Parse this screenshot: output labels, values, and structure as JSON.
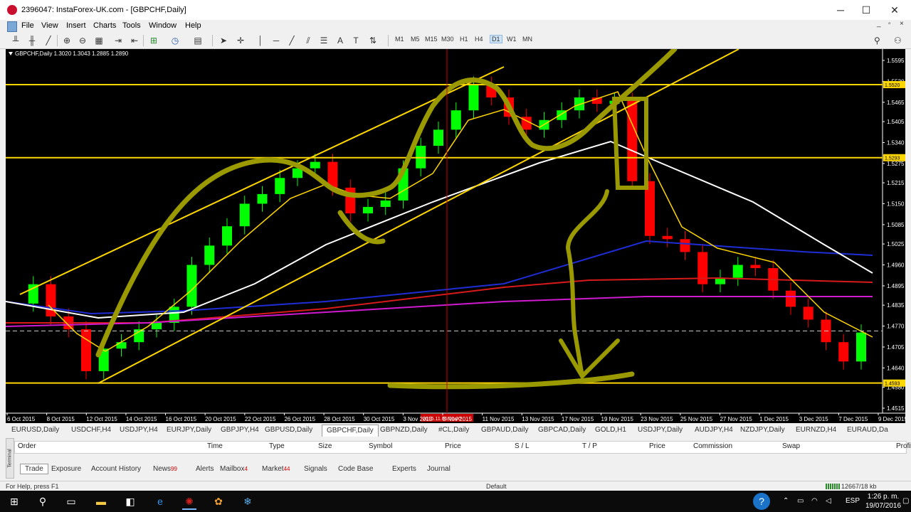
{
  "window": {
    "title": "2396047: InstaForex-UK.com - [GBPCHF,Daily]",
    "min": "─",
    "max": "☐",
    "close": "✕"
  },
  "menu": {
    "items": [
      "File",
      "View",
      "Insert",
      "Charts",
      "Tools",
      "Window",
      "Help"
    ],
    "mdi": [
      "_",
      "▫",
      "×"
    ]
  },
  "timeframes": [
    "M1",
    "M5",
    "M15",
    "M30",
    "H1",
    "H4",
    "D1",
    "W1",
    "MN"
  ],
  "active_timeframe": "D1",
  "chart": {
    "header": "GBPCHF,Daily  1.3020 1.3043 1.2885 1.2890",
    "price_labels": [
      "1.5595",
      "1.5530",
      "1.5465",
      "1.5405",
      "1.5340",
      "1.5275",
      "1.5215",
      "1.5150",
      "1.5085",
      "1.5025",
      "1.4960",
      "1.4895",
      "1.4835",
      "1.4770",
      "1.4705",
      "1.4640",
      "1.4580",
      "1.4515"
    ],
    "highlight_labels": [
      "1.5520",
      "1.5293",
      "1.4593"
    ],
    "date_labels": [
      "6 Oct 2015",
      "8 Oct 2015",
      "12 Oct 2015",
      "14 Oct 2015",
      "16 Oct 2015",
      "20 Oct 2015",
      "22 Oct 2015",
      "26 Oct 2015",
      "28 Oct 2015",
      "30 Oct 2015",
      "3 Nov 2015",
      "5 Nov 2015",
      "11 Nov 2015",
      "13 Nov 2015",
      "17 Nov 2015",
      "19 Nov 2015",
      "23 Nov 2015",
      "25 Nov 2015",
      "27 Nov 2015",
      "1 Dec 2015",
      "3 Dec 2015",
      "7 Dec 2015",
      "9 Dec 2015"
    ],
    "cursor_date": "2015.11.05 00:00",
    "colors": {
      "bull": "#00ff00",
      "bear": "#ff0000",
      "hline": "#ffd700",
      "drawing": "#9a9a00"
    }
  },
  "symbol_tabs": [
    "EURUSD,Daily",
    "USDCHF,H4",
    "USDJPY,H4",
    "EURJPY,Daily",
    "GBPJPY,H4",
    "GBPUSD,Daily",
    "GBPCHF,Daily",
    "GBPNZD,Daily",
    "#CL,Daily",
    "GBPAUD,Daily",
    "GBPCAD,Daily",
    "GOLD,H1",
    "USDJPY,Daily",
    "AUDJPY,H4",
    "NZDJPY,Daily",
    "EURNZD,H4",
    "EURAUD,Da"
  ],
  "active_symbol_tab": "GBPCHF,Daily",
  "terminal": {
    "side_label": "Terminal",
    "columns": [
      "Order",
      "Time",
      "Type",
      "Size",
      "Symbol",
      "Price",
      "S / L",
      "T / P",
      "Price",
      "Commission",
      "Swap",
      "Profit"
    ],
    "tabs": [
      {
        "label": "Trade",
        "badge": ""
      },
      {
        "label": "Exposure",
        "badge": ""
      },
      {
        "label": "Account History",
        "badge": ""
      },
      {
        "label": "News",
        "badge": "99"
      },
      {
        "label": "Alerts",
        "badge": ""
      },
      {
        "label": "Mailbox",
        "badge": "4"
      },
      {
        "label": "Market",
        "badge": "44"
      },
      {
        "label": "Signals",
        "badge": ""
      },
      {
        "label": "Code Base",
        "badge": ""
      },
      {
        "label": "Experts",
        "badge": ""
      },
      {
        "label": "Journal",
        "badge": ""
      }
    ]
  },
  "status": {
    "help": "For Help, press F1",
    "profile": "Default",
    "traffic": "12667/18 kb"
  },
  "taskbar": {
    "lang": "ESP",
    "time": "1:26 p. m.",
    "date": "19/07/2016"
  }
}
